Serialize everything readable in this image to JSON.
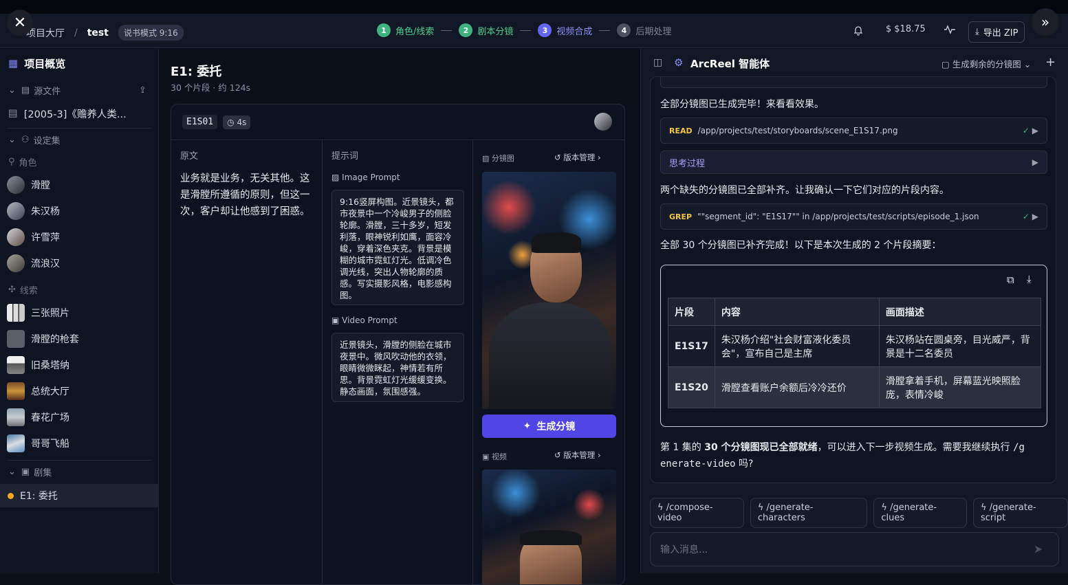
{
  "topbar": {
    "breadcrumb_home": "项目大厅",
    "project": "test",
    "mode_badge": "说书模式 9:16",
    "steps": [
      {
        "n": "1",
        "label": "角色/线索",
        "color": "#3fb27f"
      },
      {
        "n": "2",
        "label": "剧本分镜",
        "color": "#3fb27f"
      },
      {
        "n": "3",
        "label": "视频合成",
        "color": "#6366f1"
      },
      {
        "n": "4",
        "label": "后期处理",
        "color": "#4a5163"
      }
    ],
    "cost": "$18.75",
    "export": "导出 ZIP"
  },
  "sidebar": {
    "overview": "项目概览",
    "source_section": "源文件",
    "source_file": "[2005-3]《赡养人类...",
    "settings_section": "设定集",
    "roles_section": "角色",
    "roles": [
      "滑膛",
      "朱汉杨",
      "许雪萍",
      "流浪汉"
    ],
    "clues_section": "线索",
    "clues": [
      "三张照片",
      "滑膛的枪套",
      "旧桑塔纳",
      "总统大厅",
      "春花广场",
      "哥哥飞船"
    ],
    "episodes_section": "剧集",
    "episode": "E1: 委托"
  },
  "main": {
    "title": "E1: 委托",
    "subtitle": "30 个片段 · 约 124s",
    "segment": {
      "id": "E1S01",
      "duration": "4s",
      "col_original": "原文",
      "original_text": "业务就是业务，无关其他。这是滑膛所遵循的原则，但这一次，客户却让他感到了困惑。",
      "col_prompts": "提示词",
      "image_prompt_label": "Image Prompt",
      "image_prompt": "9:16竖屏构图。近景镜头，都市夜景中一个冷峻男子的侧脸轮廓。滑膛，三十多岁，短发利落，眼神锐利如鹰，面容冷峻，穿着深色夹克。背景是模糊的城市霓虹灯光。低调冷色调光线，突出人物轮廓的质感。写实摄影风格，电影感构图。",
      "video_prompt_label": "Video Prompt",
      "video_prompt": "近景镜头，滑膛的侧脸在城市夜景中。微风吹动他的衣领，眼睛微微眯起，神情若有所思。背景霓虹灯光缓缓变换。静态画面，氛围感强。",
      "storyboard_label": "分镜图",
      "version_label": "版本管理",
      "generate_button": "生成分镜",
      "video_label": "视频",
      "version_label2": "版本管理"
    }
  },
  "panel": {
    "title": "ArcReel 智能体",
    "action": "生成剩余的分镜图",
    "msg1": "全部分镜图已生成完毕！来看看效果。",
    "tool1": {
      "type": "READ",
      "text": "/app/projects/test/storyboards/scene_E1S17.png",
      "color": "#f5c542"
    },
    "thinking": "思考过程",
    "msg2": "两个缺失的分镜图已全部补齐。让我确认一下它们对应的片段内容。",
    "tool2": {
      "type": "GREP",
      "text": "\"\"segment_id\": \"E1S17\"\" in /app/projects/test/scripts/episode_1.json",
      "color": "#f5c542"
    },
    "msg3": "全部 30 个分镜图已补齐完成！以下是本次生成的 2 个片段摘要：",
    "table": {
      "headers": [
        "片段",
        "内容",
        "画面描述"
      ],
      "rows": [
        [
          "E1S17",
          "朱汉杨介绍\"社会财富液化委员会\"，宣布自己是主席",
          "朱汉杨站在圆桌旁，目光威严，背景是十二名委员"
        ],
        [
          "E1S20",
          "滑膛查看账户余额后冷冷还价",
          "滑膛拿着手机，屏幕蓝光映照脸庞，表情冷峻"
        ]
      ]
    },
    "final_a": "第 1 集的",
    "final_b": "30 个分镜图现已全部就绪",
    "final_c": "，可以进入下一步视频生成。需要我继续执行",
    "final_cmd1": "/g",
    "final_cmd2": "enerate-video",
    "final_d": "吗?",
    "chips": [
      "/compose-video",
      "/generate-characters",
      "/generate-clues",
      "/generate-script"
    ],
    "input_placeholder": "输入消息..."
  }
}
